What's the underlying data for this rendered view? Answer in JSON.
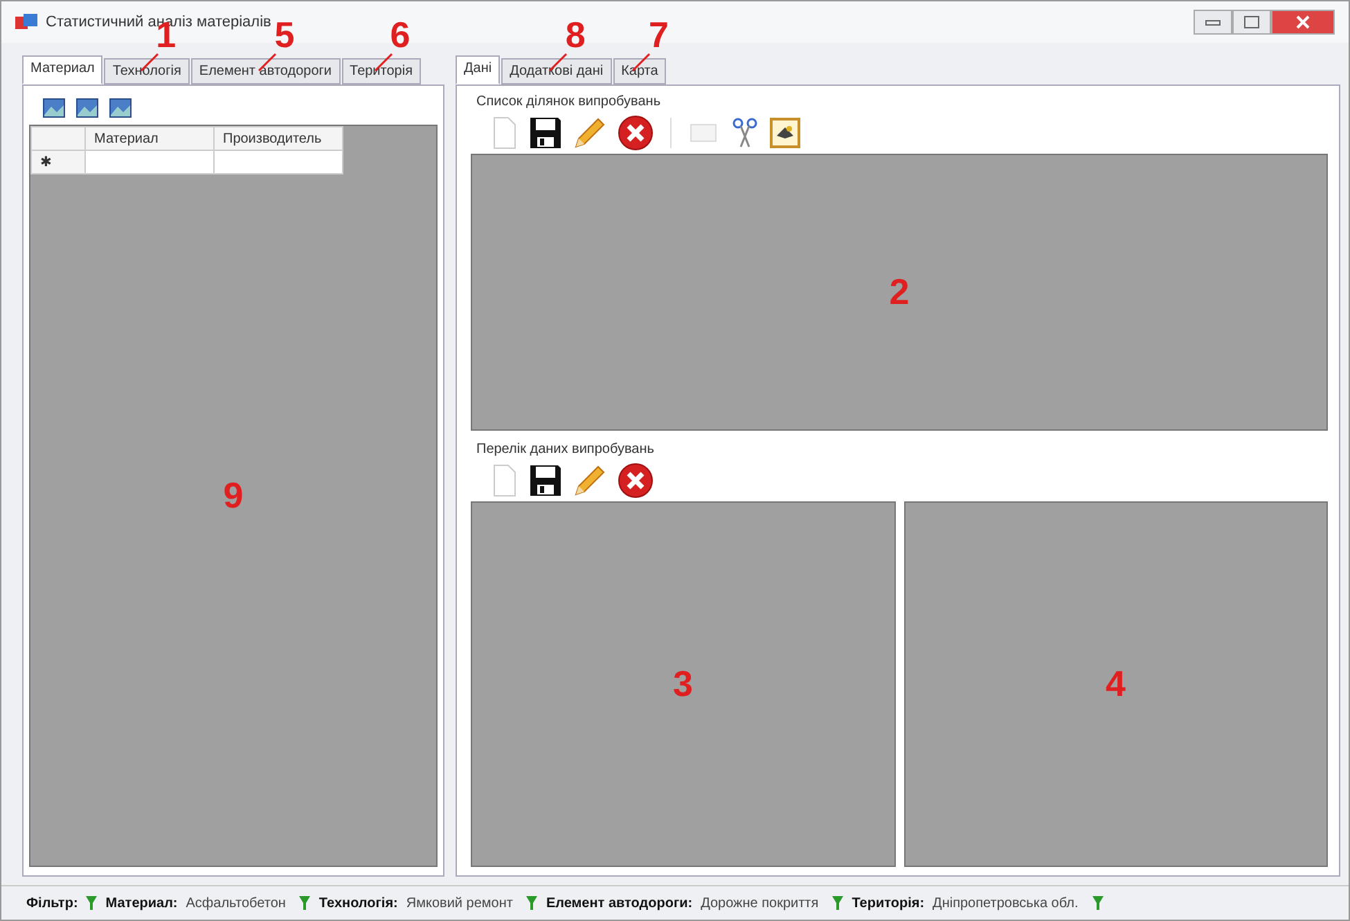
{
  "window": {
    "title": "Статистичний аналіз матеріалів"
  },
  "left_tabs": [
    {
      "label": "Материал",
      "selected": true
    },
    {
      "label": "Технологія",
      "selected": false,
      "callout": "1"
    },
    {
      "label": "Елемент автодороги",
      "selected": false,
      "callout": "5"
    },
    {
      "label": "Територія",
      "selected": false,
      "callout": "6"
    }
  ],
  "grid": {
    "columns": [
      "Материал",
      "Производитель"
    ],
    "new_row_marker": "✱"
  },
  "left_panel": {
    "callout": "9"
  },
  "right_tabs": [
    {
      "label": "Дані",
      "selected": true
    },
    {
      "label": "Додаткові дані",
      "selected": false,
      "callout": "8"
    },
    {
      "label": "Карта",
      "selected": false,
      "callout": "7"
    }
  ],
  "sections": [
    {
      "title": "Список ділянок випробувань",
      "panels": [
        {
          "callout": "2"
        }
      ]
    },
    {
      "title": "Перелік даних випробувань",
      "panels": [
        {
          "callout": "3"
        },
        {
          "callout": "4"
        }
      ]
    }
  ],
  "status_bar": {
    "prefix": "Фільтр:",
    "filters": [
      {
        "label": "Материал:",
        "value": "Асфальтобетон"
      },
      {
        "label": "Технологія:",
        "value": "Ямковий ремонт"
      },
      {
        "label": "Елемент автодороги:",
        "value": "Дорожне покриття"
      },
      {
        "label": "Територія:",
        "value": "Дніпропетровська обл."
      }
    ]
  }
}
